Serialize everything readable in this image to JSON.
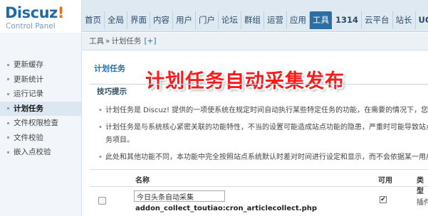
{
  "logo": {
    "main": "Discuz",
    "bang": "!",
    "sub": "Control Panel"
  },
  "topnav": [
    {
      "label": "首页"
    },
    {
      "label": "全局"
    },
    {
      "label": "界面"
    },
    {
      "label": "内容"
    },
    {
      "label": "用户"
    },
    {
      "label": "门户"
    },
    {
      "label": "论坛"
    },
    {
      "label": "群组"
    },
    {
      "label": "运营"
    },
    {
      "label": "应用"
    },
    {
      "label": "工具",
      "active": true
    },
    {
      "label": "1314"
    },
    {
      "label": "云平台"
    },
    {
      "label": "站长"
    },
    {
      "label": "UC"
    }
  ],
  "breadcrumb": {
    "parent": "工具",
    "sep": "»",
    "current": "计划任务",
    "add": "[+]"
  },
  "sidebar": {
    "items": [
      {
        "label": "更新缓存"
      },
      {
        "label": "更新统计"
      },
      {
        "label": "运行记录"
      },
      {
        "label": "计划任务",
        "active": true
      },
      {
        "label": "文件权限检查"
      },
      {
        "label": "文件校验"
      },
      {
        "label": "嵌入点校验"
      }
    ]
  },
  "main": {
    "section_title": "计划任务",
    "overlay_title": "计划任务自动采集发布",
    "tips_header": "技巧提示",
    "tips": [
      "计划任务是 Discuz! 提供的一项使系统在规定时间自动执行某些特定任务的功能，在需要的情况下，您也可",
      "计划任务是与系统核心紧密关联的功能特性，不当的设置可能造成站点功能的隐患，严重时可能导致站点无",
      "务项目。",
      "此处和其他功能不同，本功能中完全按照站点系统默认时差对时间进行设定和显示，而不会依据某一用户或"
    ],
    "table": {
      "headers": {
        "name": "名称",
        "available": "可用",
        "type": "类型"
      },
      "rows": [
        {
          "name": "今日头条自动采集",
          "file": "addon_collect_toutiao:cron_articlecollect.php",
          "available": true,
          "available_mark": "✔",
          "type": "插件"
        }
      ]
    }
  },
  "colors": {
    "accent": "#2b6fa5",
    "overlay_red": "#ff1a1a",
    "logo_orange": "#f06a1c"
  }
}
